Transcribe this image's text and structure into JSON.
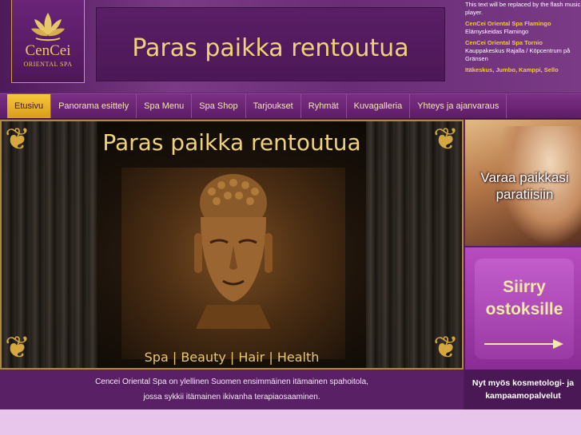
{
  "logo": {
    "name": "CenCei",
    "subtitle": "ORIENTAL SPA"
  },
  "banner": {
    "text": "Paras paikka rentoutua"
  },
  "flash": {
    "notice": "This text will be replaced by the flash music player.",
    "locations": [
      {
        "name": "CenCei Oriental Spa Flamingo",
        "detail": "Elämyskeidas Flamingo"
      },
      {
        "name": "CenCei Oriental Spa Tornio",
        "detail": "Kauppakeskus Rajalla / Köpcentrum på Gränsen"
      }
    ],
    "coming": "Itäkeskus, Jumbo, Kamppi, Sello"
  },
  "nav": {
    "items": [
      {
        "label": "Etusivu",
        "active": true
      },
      {
        "label": "Panorama esittely",
        "active": false
      },
      {
        "label": "Spa Menu",
        "active": false
      },
      {
        "label": "Spa Shop",
        "active": false
      },
      {
        "label": "Tarjoukset",
        "active": false
      },
      {
        "label": "Ryhmät",
        "active": false
      },
      {
        "label": "Kuvagalleria",
        "active": false
      },
      {
        "label": "Yhteys ja ajanvaraus",
        "active": false
      }
    ]
  },
  "hero": {
    "title": "Paras paikka rentoutua",
    "tagline": "Spa | Beauty | Hair | Health"
  },
  "promos": {
    "booking": "Varaa paikkasi paratiisiin",
    "shop": "Siirry ostoksille",
    "services": "Nyt myös kosmetologi- ja kampaamopalvelut"
  },
  "caption": {
    "line1": "Cencei Oriental Spa on ylellinen Suomen ensimmäinen itämainen spahoitola,",
    "line2": "jossa sykkii itämainen ikivanha terapiaosaaminen."
  },
  "colors": {
    "accent_gold": "#f2c93a",
    "brand_purple": "#5a2066",
    "nav_active": "#f6c73d"
  }
}
